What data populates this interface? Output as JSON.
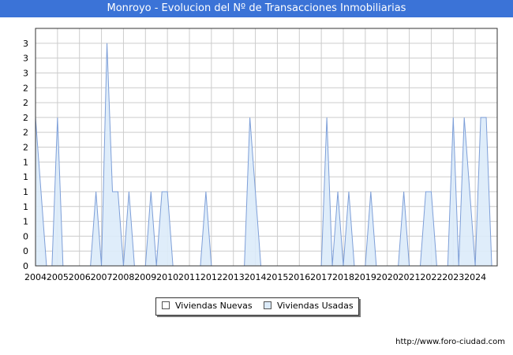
{
  "header": {
    "title": "Monroyo - Evolucion del Nº de Transacciones Inmobiliarias"
  },
  "footer": {
    "credit": "http://www.foro-ciudad.com"
  },
  "colors": {
    "title_bar": "#3b73d7",
    "nuevas_fill": "#ffffff",
    "usadas_fill": "#dcebfa",
    "usadas_line": "#7e9fd8",
    "grid": "#cccccc"
  },
  "chart_data": {
    "type": "area",
    "title": "Monroyo - Evolucion del Nº de Transacciones Inmobiliarias",
    "xlabel": "",
    "ylabel": "",
    "xlim": [
      2004,
      2025
    ],
    "ylim": [
      0,
      3.2
    ],
    "x_tick_labels": [
      "2004",
      "2005",
      "2006",
      "2007",
      "2008",
      "2009",
      "2010",
      "2011",
      "2012",
      "2013",
      "2014",
      "2015",
      "2016",
      "2017",
      "2018",
      "2019",
      "2020",
      "2021",
      "2022",
      "2023",
      "2024"
    ],
    "y_tick_labels": [
      "0",
      "0",
      "0",
      "1",
      "1",
      "1",
      "1",
      "1",
      "2",
      "2",
      "2",
      "2",
      "2",
      "3",
      "3",
      "3",
      "3"
    ],
    "y_tick_values": [
      0,
      0.2,
      0.4,
      0.6,
      0.8,
      1.0,
      1.2,
      1.4,
      1.6,
      1.8,
      2.0,
      2.2,
      2.4,
      2.6,
      2.8,
      3.0,
      3.2
    ],
    "grid": true,
    "legend_position": "bottom",
    "legend": [
      "Viviendas Nuevas",
      "Viviendas Usadas"
    ],
    "series": [
      {
        "name": "Viviendas Nuevas",
        "points": []
      },
      {
        "name": "Viviendas Usadas",
        "points": [
          [
            2004.0,
            2
          ],
          [
            2004.25,
            1
          ],
          [
            2004.5,
            0
          ],
          [
            2004.75,
            0
          ],
          [
            2005.0,
            2
          ],
          [
            2005.25,
            0
          ],
          [
            2006.5,
            0
          ],
          [
            2006.75,
            1
          ],
          [
            2007.0,
            0
          ],
          [
            2007.25,
            3
          ],
          [
            2007.5,
            1
          ],
          [
            2007.75,
            1
          ],
          [
            2008.0,
            0
          ],
          [
            2008.25,
            1
          ],
          [
            2008.5,
            0
          ],
          [
            2009.0,
            0
          ],
          [
            2009.25,
            1
          ],
          [
            2009.5,
            0
          ],
          [
            2009.75,
            1
          ],
          [
            2010.0,
            1
          ],
          [
            2010.25,
            0
          ],
          [
            2011.5,
            0
          ],
          [
            2011.75,
            1
          ],
          [
            2012.0,
            0
          ],
          [
            2013.5,
            0
          ],
          [
            2013.75,
            2
          ],
          [
            2014.25,
            0
          ],
          [
            2017.0,
            0
          ],
          [
            2017.25,
            2
          ],
          [
            2017.5,
            0
          ],
          [
            2017.75,
            1
          ],
          [
            2018.0,
            0
          ],
          [
            2018.25,
            1
          ],
          [
            2018.5,
            0
          ],
          [
            2019.0,
            0
          ],
          [
            2019.25,
            1
          ],
          [
            2019.5,
            0
          ],
          [
            2020.5,
            0
          ],
          [
            2020.75,
            1
          ],
          [
            2021.0,
            0
          ],
          [
            2021.5,
            0
          ],
          [
            2021.75,
            1
          ],
          [
            2022.0,
            1
          ],
          [
            2022.25,
            0
          ],
          [
            2022.75,
            0
          ],
          [
            2023.0,
            2
          ],
          [
            2023.25,
            0
          ],
          [
            2023.5,
            2
          ],
          [
            2023.75,
            1
          ],
          [
            2024.0,
            0
          ],
          [
            2024.25,
            2
          ],
          [
            2024.5,
            2
          ],
          [
            2024.75,
            0
          ]
        ]
      }
    ]
  }
}
